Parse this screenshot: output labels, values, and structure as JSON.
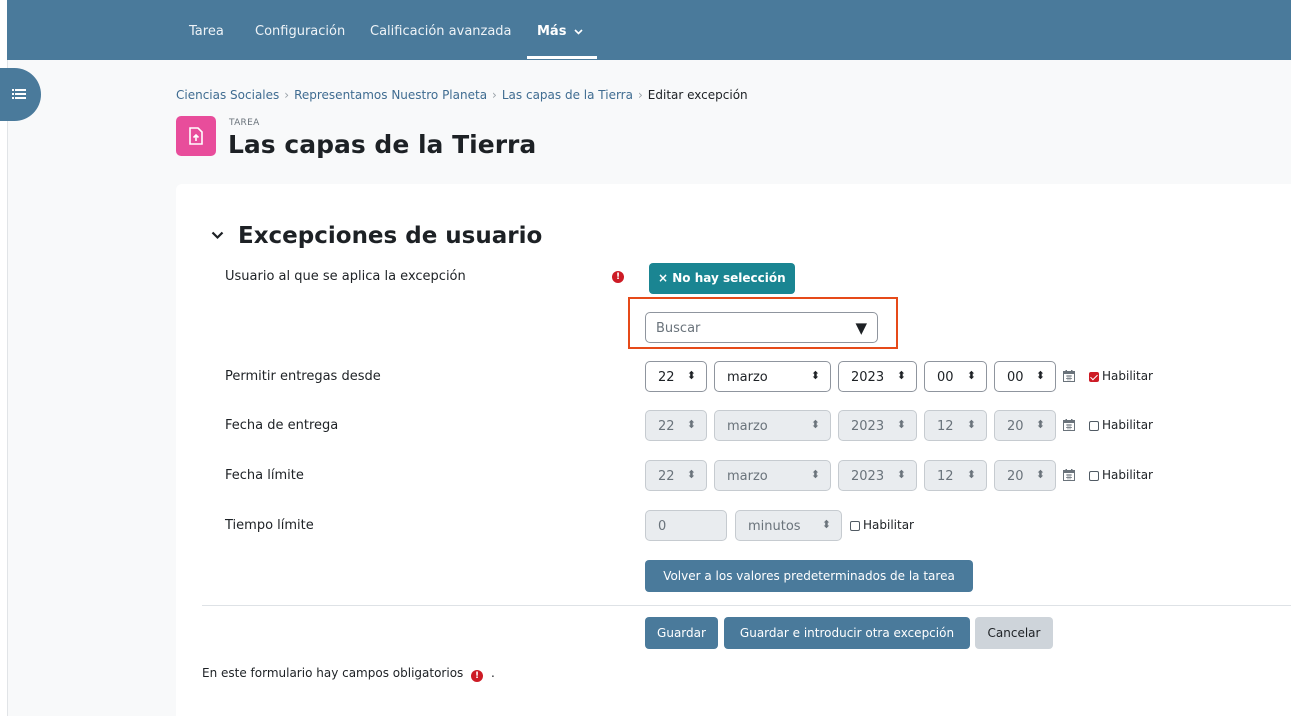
{
  "nav": {
    "items": [
      {
        "label": "Tarea"
      },
      {
        "label": "Configuración"
      },
      {
        "label": "Calificación avanzada"
      },
      {
        "label": "Más"
      }
    ]
  },
  "breadcrumb": {
    "items": [
      "Ciencias Sociales",
      "Representamos Nuestro Planeta",
      "Las capas de la Tierra"
    ],
    "current": "Editar excepción"
  },
  "header": {
    "activity_type": "TAREA",
    "title": "Las capas de la Tierra"
  },
  "section": {
    "title": "Excepciones de usuario"
  },
  "form": {
    "user": {
      "label": "Usuario al que se aplica la excepción",
      "chip": "× No hay selección",
      "search_placeholder": "Buscar"
    },
    "allow_from": {
      "label": "Permitir entregas desde",
      "day": "22",
      "month": "marzo",
      "year": "2023",
      "hour": "00",
      "minute": "00",
      "enable_label": "Habilitar",
      "enabled": true
    },
    "due_date": {
      "label": "Fecha de entrega",
      "day": "22",
      "month": "marzo",
      "year": "2023",
      "hour": "12",
      "minute": "20",
      "enable_label": "Habilitar",
      "enabled": false
    },
    "cutoff": {
      "label": "Fecha límite",
      "day": "22",
      "month": "marzo",
      "year": "2023",
      "hour": "12",
      "minute": "20",
      "enable_label": "Habilitar",
      "enabled": false
    },
    "time_limit": {
      "label": "Tiempo límite",
      "value": "0",
      "unit": "minutos",
      "enable_label": "Habilitar",
      "enabled": false
    },
    "reset_button": "Volver a los valores predeterminados de la tarea"
  },
  "actions": {
    "save": "Guardar",
    "save_another": "Guardar e introducir otra excepción",
    "cancel": "Cancelar"
  },
  "footer": {
    "required_note": "En este formulario hay campos obligatorios",
    "trailing": "."
  },
  "colors": {
    "nav_bg": "#4a7a9b",
    "activity_icon": "#e84d9b",
    "chip_bg": "#1a8592",
    "required": "#cd1b25",
    "highlight": "#e64a19"
  }
}
